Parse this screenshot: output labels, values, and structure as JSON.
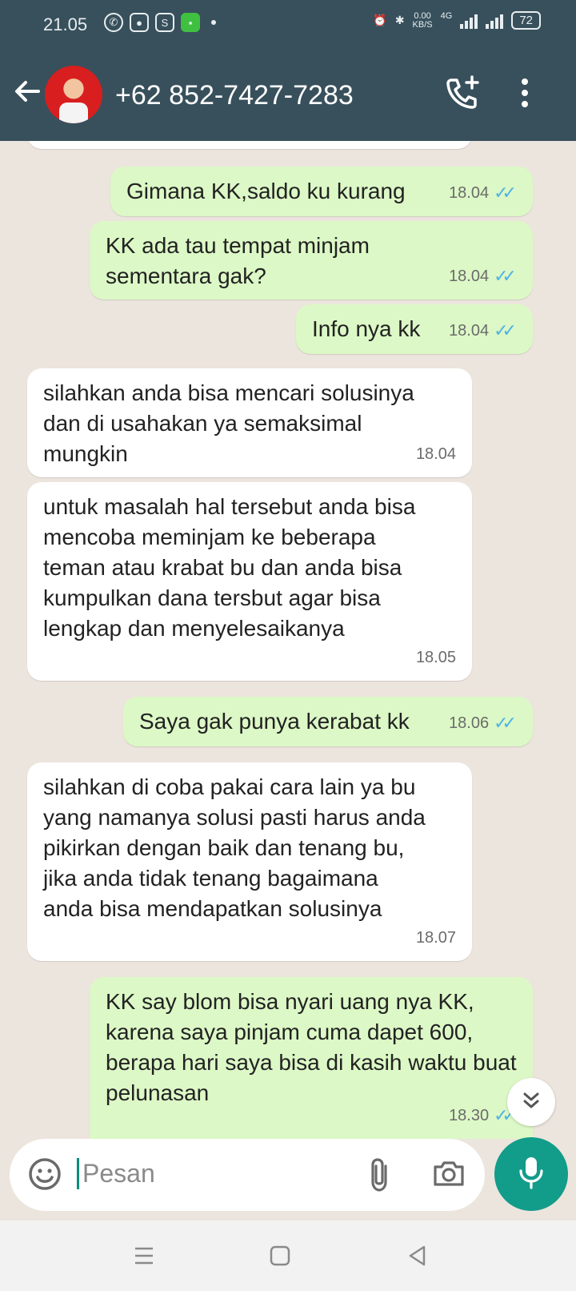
{
  "status_bar": {
    "time": "21.05",
    "speed_value": "0.00",
    "speed_unit": "KB/S",
    "network": "4G",
    "battery": "72"
  },
  "header": {
    "contact_name": "+62 852-7427-7283"
  },
  "messages": [
    {
      "text": "Gimana KK,saldo ku kurang",
      "time": "18.04",
      "direction": "outgoing"
    },
    {
      "text": "KK ada tau tempat minjam sementara gak?",
      "time": "18.04",
      "direction": "outgoing"
    },
    {
      "text": "Info nya kk",
      "time": "18.04",
      "direction": "outgoing"
    },
    {
      "text": "silahkan anda bisa mencari solusinya dan di usahakan ya semaksimal mungkin",
      "time": "18.04",
      "direction": "incoming"
    },
    {
      "text": "untuk masalah hal tersebut anda bisa mencoba meminjam ke beberapa teman atau krabat bu dan anda bisa kumpulkan dana tersbut agar bisa lengkap dan menyelesaikanya",
      "time": "18.05",
      "direction": "incoming"
    },
    {
      "text": "Saya gak punya kerabat kk",
      "time": "18.06",
      "direction": "outgoing"
    },
    {
      "text": "silahkan di coba pakai cara lain ya bu yang namanya solusi pasti harus anda pikirkan dengan baik dan tenang bu, jika anda tidak tenang bagaimana anda bisa mendapatkan solusinya",
      "time": "18.07",
      "direction": "incoming"
    },
    {
      "text": "KK say blom bisa nyari uang nya KK, karena saya pinjam cuma dapet 600, berapa hari saya bisa di kasih waktu buat pelunasan",
      "time": "18.30",
      "direction": "outgoing"
    }
  ],
  "composer": {
    "placeholder": "Pesan"
  },
  "icons": {
    "back": "arrow-left-icon",
    "call": "add-call-icon",
    "menu": "more-vert-icon",
    "emoji": "emoji-icon",
    "attach": "paperclip-icon",
    "camera": "camera-icon",
    "mic": "mic-icon",
    "scroll": "double-chevron-down-icon"
  },
  "colors": {
    "header": "#38505c",
    "outgoing_bubble": "#dcf8c6",
    "incoming_bubble": "#ffffff",
    "mic_button": "#129c8a",
    "read_ticks": "#4fb3e6",
    "chat_background": "#ece5dd"
  }
}
